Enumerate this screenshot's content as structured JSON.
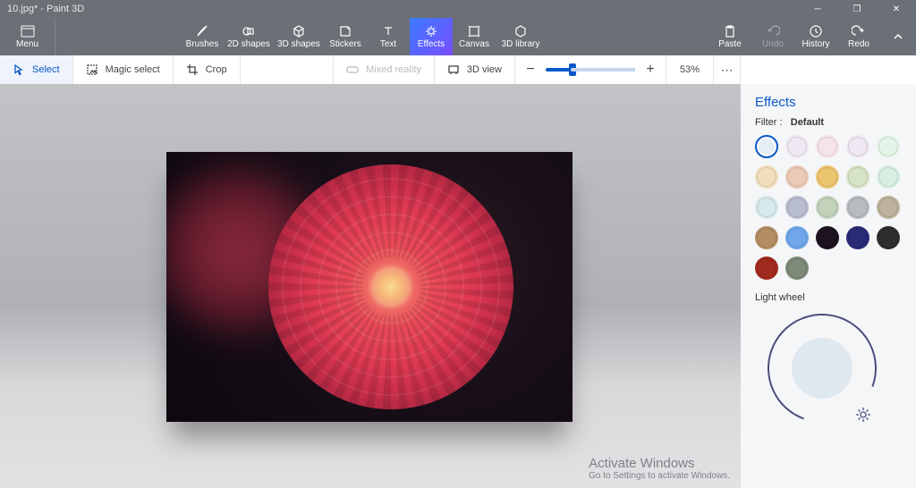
{
  "title": "10.jpg* - Paint 3D",
  "menu_label": "Menu",
  "ribbon": {
    "brushes": "Brushes",
    "shapes2d": "2D shapes",
    "shapes3d": "3D shapes",
    "stickers": "Stickers",
    "text": "Text",
    "effects": "Effects",
    "canvas": "Canvas",
    "library3d": "3D library",
    "paste": "Paste",
    "undo": "Undo",
    "redo": "Redo",
    "history": "History"
  },
  "toolbar": {
    "select": "Select",
    "magic_select": "Magic select",
    "crop": "Crop",
    "mixed_reality": "Mixed reality",
    "view3d": "3D view",
    "zoom_pct": "53%"
  },
  "side": {
    "title": "Effects",
    "filter_label": "Filter :",
    "filter_value": "Default",
    "light_wheel": "Light wheel",
    "swatches": [
      "#e5eef3",
      "#efe8f2",
      "#f5e4ea",
      "#efe8f2",
      "#e5f4e8",
      "#f1debc",
      "#eccab8",
      "#ecc570",
      "#d7e3c5",
      "#d7efe2",
      "#d7e9ea",
      "#b9bdd0",
      "#c2d2bb",
      "#b7bcc0",
      "#bdb29c",
      "#b38e63",
      "#6fa7ea",
      "#1d1320",
      "#2a2b76",
      "#2e2e2e",
      "#a12a1e",
      "#7d8a78"
    ]
  },
  "watermark": {
    "line1": "Activate Windows",
    "line2": "Go to Settings to activate Windows."
  }
}
